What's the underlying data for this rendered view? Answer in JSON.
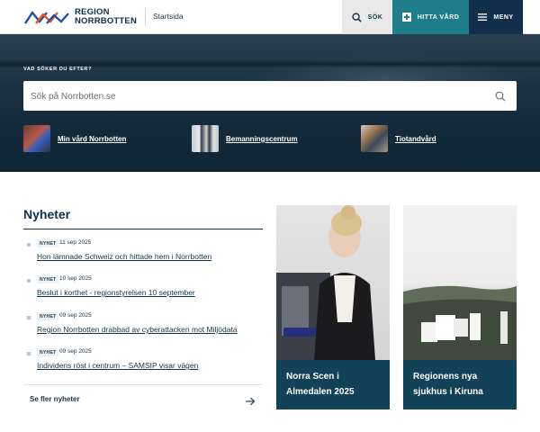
{
  "header": {
    "logo_line1": "REGION",
    "logo_line2": "NORRBOTTEN",
    "startsida": "Startsida",
    "search_label": "SÖK",
    "hitta_vard_label": "HITTA VÅRD",
    "meny_label": "MENY"
  },
  "hero": {
    "label": "VAD SÖKER DU EFTER?",
    "search_placeholder": "Sök på Norrbotten.se",
    "quick_links": [
      {
        "label": "Min vård Norrbotten",
        "icon": "phone-in-hand-photo"
      },
      {
        "label": "Bemanningscentrum",
        "icon": "staff-group-photo"
      },
      {
        "label": "Tiotandvård",
        "icon": "dental-care-photo"
      }
    ]
  },
  "news": {
    "title": "Nyheter",
    "items": [
      {
        "badge": "NYHET",
        "date": "11 sep 2025",
        "headline": "Hon lämnade Schweiz och hittade hem i Norrbotten"
      },
      {
        "badge": "NYHET",
        "date": "10 sep 2025",
        "headline": "Beslut i korthet - regionstyrelsen 10 september"
      },
      {
        "badge": "NYHET",
        "date": "09 sep 2025",
        "headline": "Region Norrbotten drabbad av cyberattacken mot Miljödata"
      },
      {
        "badge": "NYHET",
        "date": "09 sep 2025",
        "headline": "Individens röst i centrum – SAMSIP visar vägen"
      }
    ],
    "more_label": "Se fler nyheter"
  },
  "cards": [
    {
      "caption": "Norra Scen i Almedalen 2025"
    },
    {
      "caption": "Regionens nya sjukhus i Kiruna"
    }
  ],
  "colors": {
    "navy": "#0f2f4a",
    "teal": "#207e8c",
    "card_caption": "#124257"
  }
}
